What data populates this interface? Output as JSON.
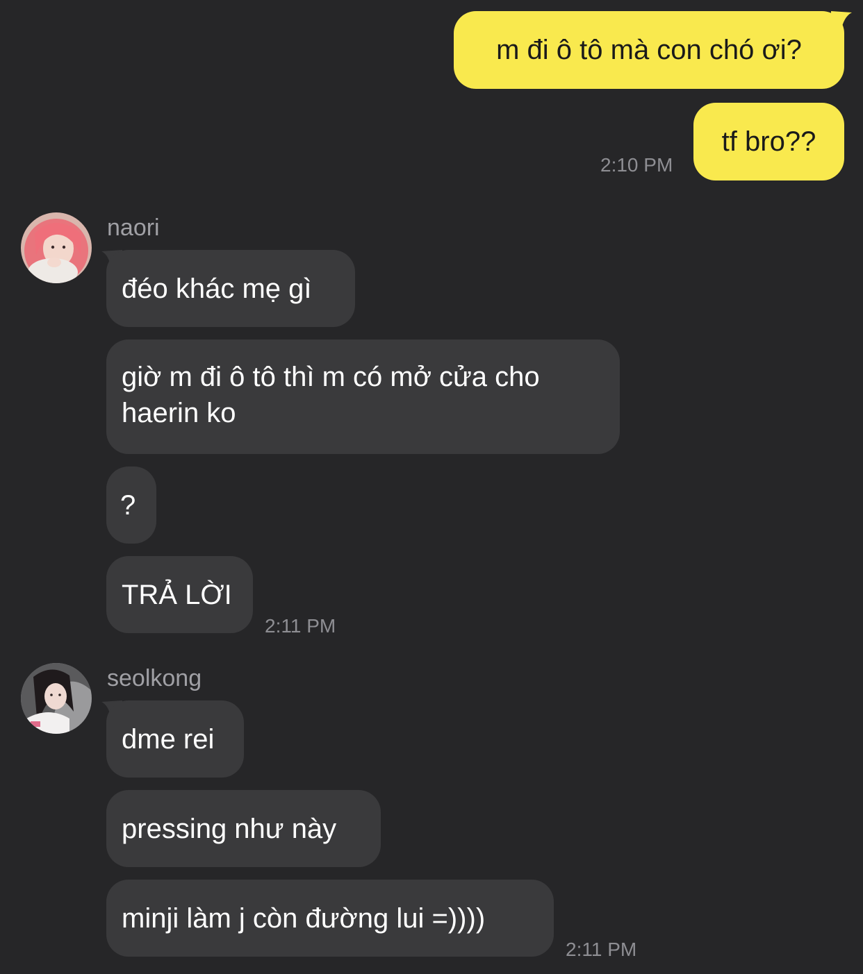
{
  "messages_me": {
    "m1": "m đi ô tô mà con chó ơi?",
    "m2": "tf bro??",
    "time": "2:10 PM"
  },
  "naori": {
    "name": "naori",
    "m1": "đéo khác mẹ gì",
    "m2": "giờ m đi ô tô thì m có mở cửa cho haerin ko",
    "m3": "?",
    "m4": "TRẢ LỜI",
    "time": "2:11 PM"
  },
  "seolkong": {
    "name": "seolkong",
    "m1": "dme rei",
    "m2": "pressing như này",
    "m3": "minji làm j còn đường lui =))))",
    "time": "2:11 PM"
  },
  "colors": {
    "background": "#262628",
    "outgoing_bubble": "#f9e94e",
    "incoming_bubble": "#3a3a3c",
    "timestamp": "#8e8e93"
  }
}
